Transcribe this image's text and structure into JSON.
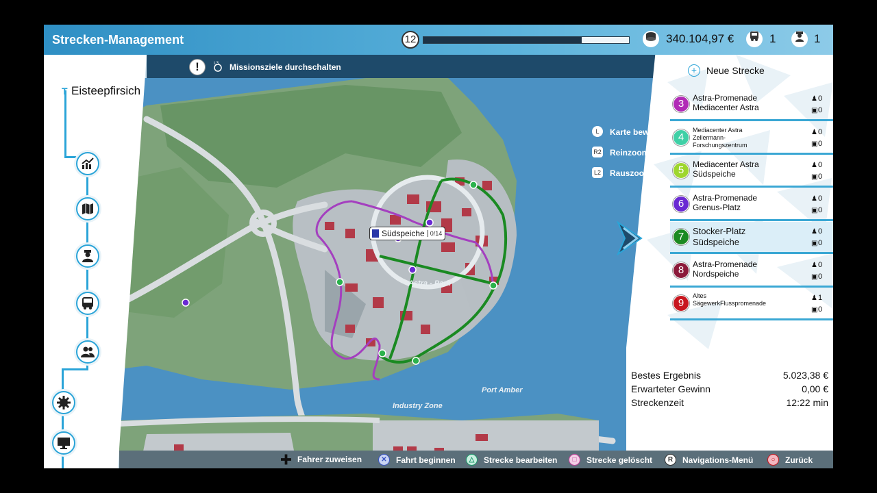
{
  "header": {
    "title": "Strecken-Management",
    "level": "12",
    "xp_progress": 0.77,
    "money": "340.104,97 €",
    "buses": "1",
    "drivers": "1"
  },
  "mission": {
    "toggle_key": "L3",
    "toggle_label": "Missionsziele durchschalten"
  },
  "company": {
    "name": "Eisteepfirsich"
  },
  "sidebar": {
    "items": [
      {
        "icon": "chart-icon"
      },
      {
        "icon": "map-icon"
      },
      {
        "icon": "driver-icon"
      },
      {
        "icon": "bus-icon"
      },
      {
        "icon": "people-icon"
      },
      {
        "icon": "settings-gear-icon"
      },
      {
        "icon": "monitor-icon"
      }
    ]
  },
  "map_hints": {
    "move_key": "L",
    "move_label": "Karte bewegen",
    "zoom_in_key": "R2",
    "zoom_in_label": "Reinzoomen",
    "zoom_out_key": "L2",
    "zoom_out_label": "Rauszoomen"
  },
  "map": {
    "stop_label": "Südspeiche",
    "stop_count": "0/14",
    "area_astra": "Astra - Park",
    "area_port": "Port Amber",
    "area_industry": "Industry Zone"
  },
  "routes_panel": {
    "new_route_label": "Neue Strecke",
    "routes": [
      {
        "number": "3",
        "name1": "Astra-Promenade",
        "name2": "Mediacenter Astra",
        "drivers": "0",
        "buses": "0",
        "color": "#b12bb6",
        "size": "normal"
      },
      {
        "number": "4",
        "name1": "Mediacenter Astra",
        "name2": "Zellermann-",
        "name3": "Forschungszentrum",
        "drivers": "0",
        "buses": "0",
        "color": "#3fd0a6",
        "size": "small"
      },
      {
        "number": "5",
        "name1": "Mediacenter Astra",
        "name2": "Südspeiche",
        "drivers": "0",
        "buses": "0",
        "color": "#9ed62e",
        "size": "normal"
      },
      {
        "number": "6",
        "name1": "Astra-Promenade",
        "name2": "Grenus-Platz",
        "drivers": "0",
        "buses": "0",
        "color": "#6a2ad3",
        "size": "normal"
      },
      {
        "number": "7",
        "name1": "Stocker-Platz",
        "name2": "Südspeiche",
        "drivers": "0",
        "buses": "0",
        "color": "#1a8a22",
        "size": "mid"
      },
      {
        "number": "8",
        "name1": "Astra-Promenade",
        "name2": "Nordspeiche",
        "drivers": "0",
        "buses": "0",
        "color": "#8b1a3a",
        "size": "normal"
      },
      {
        "number": "9",
        "name1": "Altes",
        "name2": "SägewerkFlusspromenade",
        "drivers": "1",
        "buses": "0",
        "color": "#c8161e",
        "size": "small"
      }
    ]
  },
  "stats": {
    "best_label": "Bestes Ergebnis",
    "best_value": "5.023,38 €",
    "expected_label": "Erwarteter Gewinn",
    "expected_value": "0,00 €",
    "time_label": "Streckenzeit",
    "time_value": "12:22 min"
  },
  "bottom_bar": {
    "assign": "Fahrer zuweisen",
    "start": "Fahrt beginnen",
    "edit": "Strecke bearbeiten",
    "deleted": "Strecke gelöscht",
    "nav_key": "R",
    "nav": "Navigations-Menü",
    "back": "Zurück"
  },
  "colors": {
    "accent": "#2aa4d8",
    "header_dark": "#1e4a6a",
    "water": "#4b91c3",
    "land": "#7ea37a",
    "route_green": "#1a8a22",
    "route_purple": "#a43fbf"
  }
}
